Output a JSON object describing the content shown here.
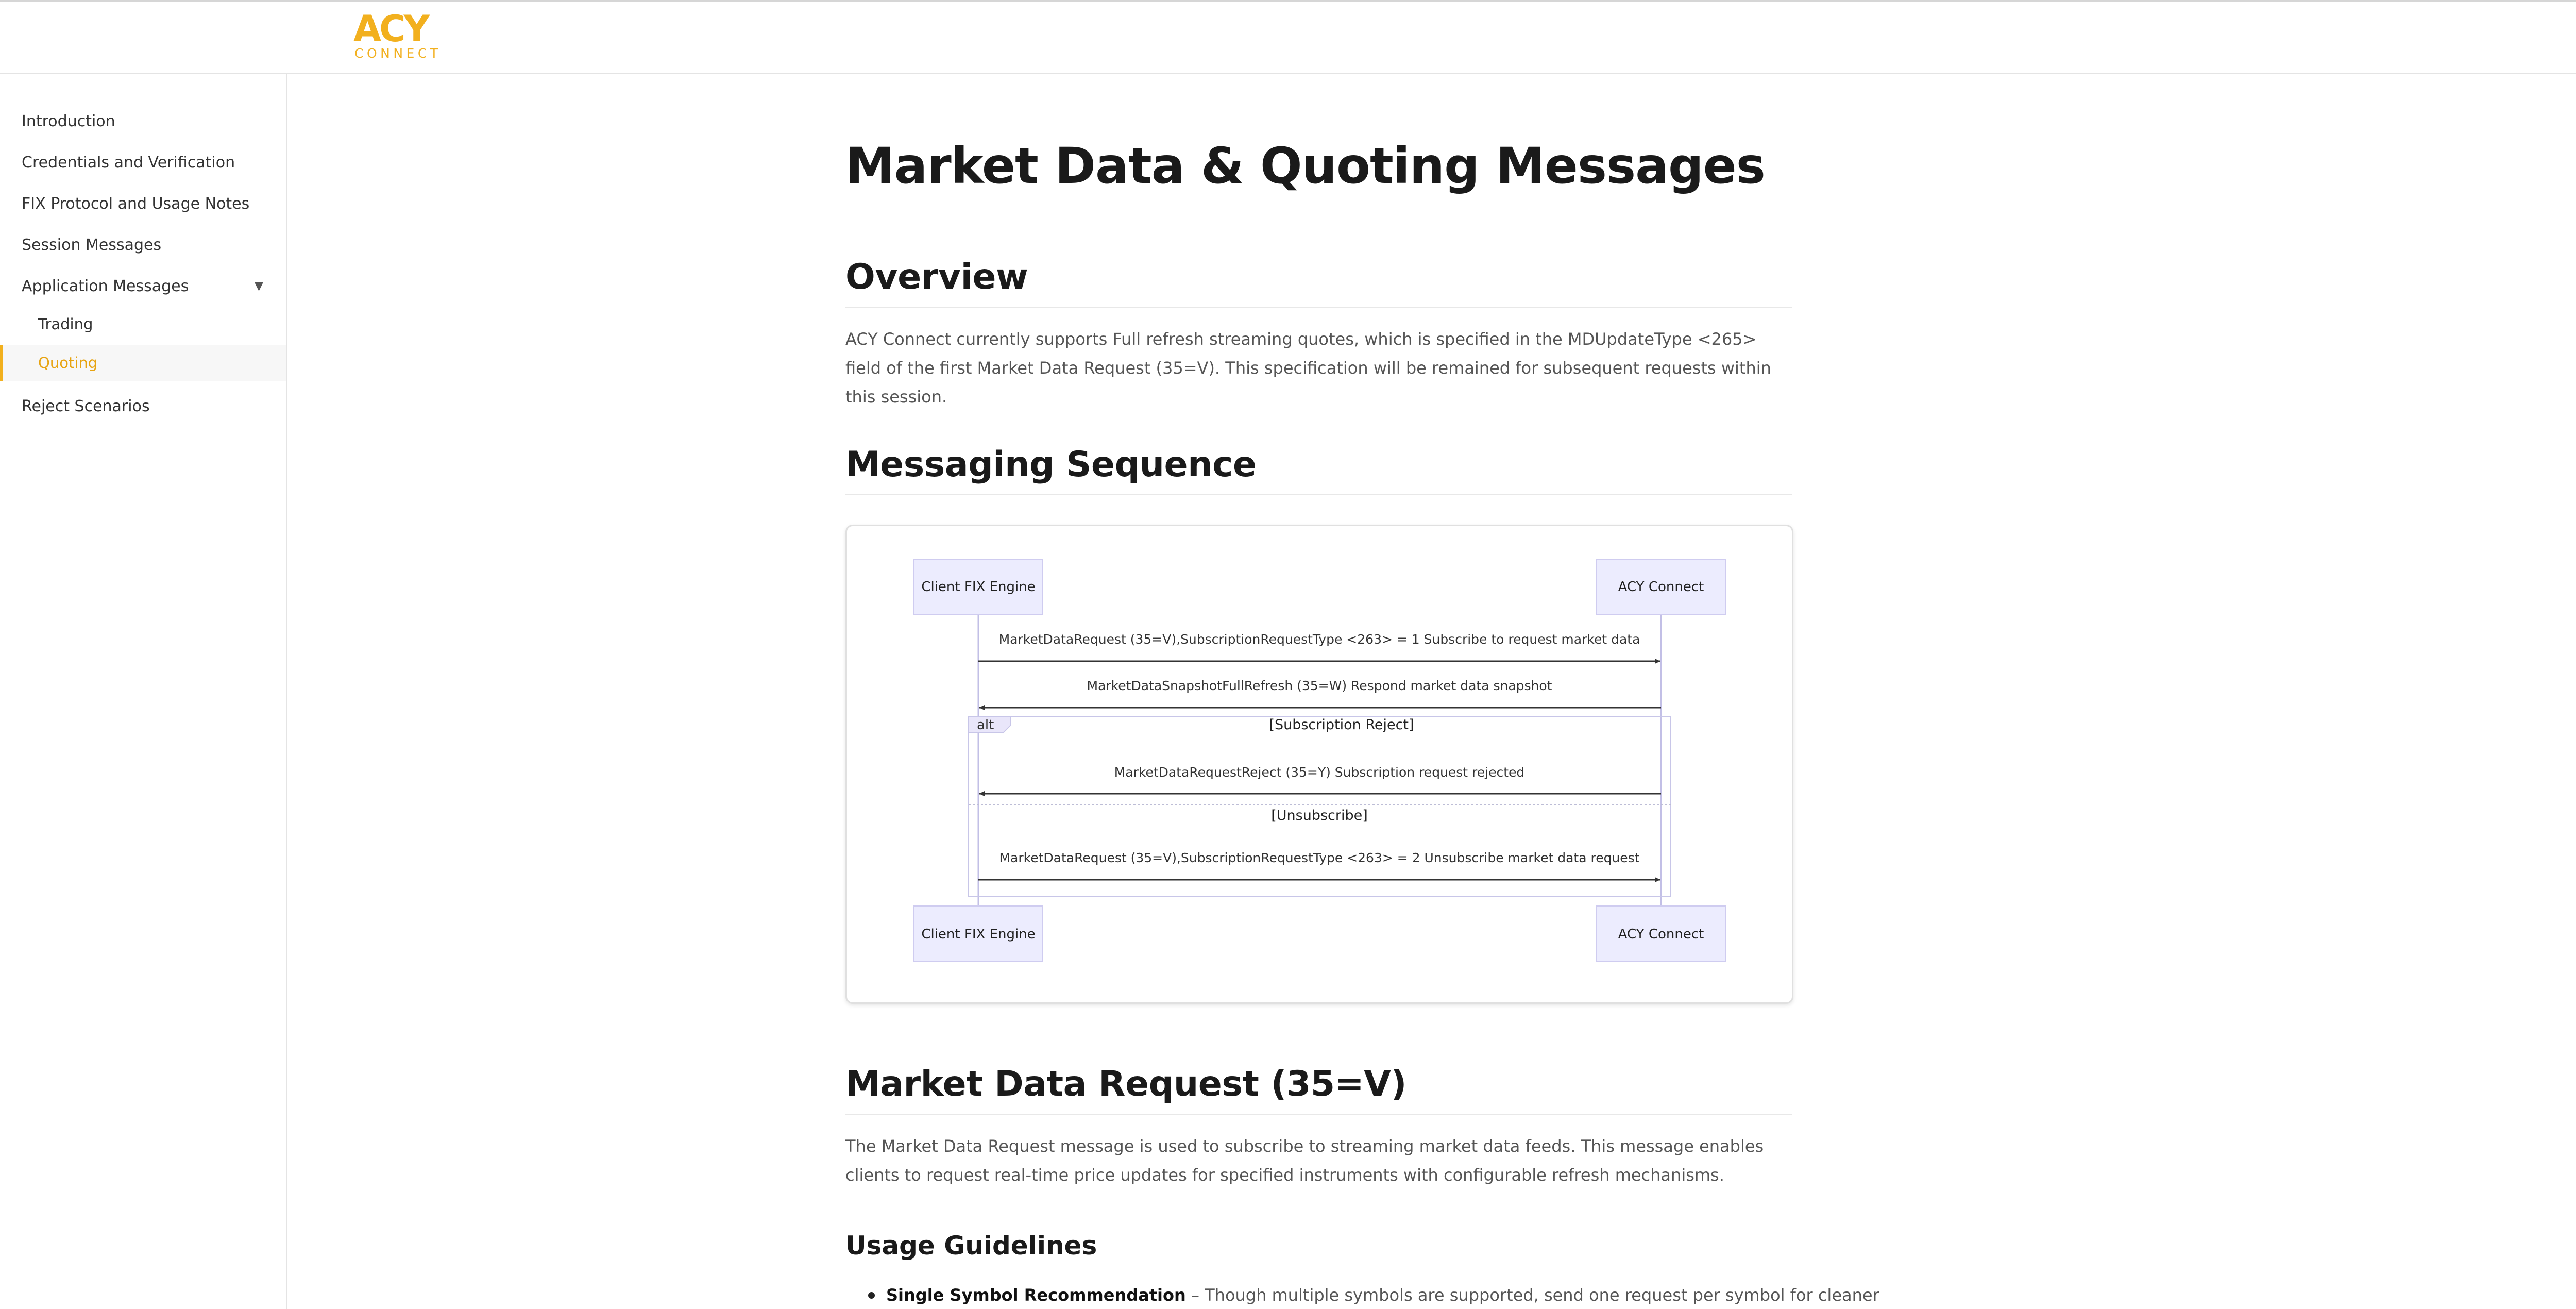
{
  "header": {
    "logo_word": "CONNECT",
    "brand_color": "#f2b01e"
  },
  "sidebar": {
    "items": [
      {
        "label": "Introduction"
      },
      {
        "label": "Credentials and Verification"
      },
      {
        "label": "FIX Protocol and Usage Notes"
      },
      {
        "label": "Session Messages"
      },
      {
        "label": "Application Messages",
        "icon": "caret-down-icon",
        "expanded": true
      },
      {
        "label": "Trading"
      },
      {
        "label": "Quoting",
        "active": true
      },
      {
        "label": "Reject Scenarios"
      }
    ],
    "active_color": "#e7a310"
  },
  "main": {
    "title": "Market Data & Quoting Messages",
    "overview": {
      "heading": "Overview",
      "text": "ACY Connect currently supports Full refresh streaming quotes, which is specified in the MDUpdateType <265> field of the first Market Data Request (35=V). This specification will be remained for subsequent requests within this session."
    },
    "sequence": {
      "heading": "Messaging Sequence",
      "participants": [
        "Client FIX Engine",
        "ACY Connect"
      ],
      "messages": [
        "MarketDataRequest (35=V),SubscriptionRequestType <263> = 1 Subscribe to request market data",
        "MarketDataSnapshotFullRefresh (35=W) Respond market data snapshot",
        "MarketDataRequestReject (35=Y) Subscription request rejected",
        "MarketDataRequest (35=V),SubscriptionRequestType <263> = 2 Unsubscribe market data request"
      ],
      "alt_label": "alt",
      "alt_conditions": [
        "[Subscription Reject]",
        "[Unsubscribe]"
      ]
    },
    "mdr": {
      "heading": "Market Data Request (35=V)",
      "text": "The Market Data Request message is used to subscribe to streaming market data feeds. This message enables clients to request real-time price updates for specified instruments with configurable refresh mechanisms."
    },
    "usage": {
      "heading": "Usage Guidelines",
      "bullet_strong": "Single Symbol Recommendation",
      "bullet_rest": " – Though multiple symbols are supported, send one request per symbol for cleaner"
    }
  }
}
